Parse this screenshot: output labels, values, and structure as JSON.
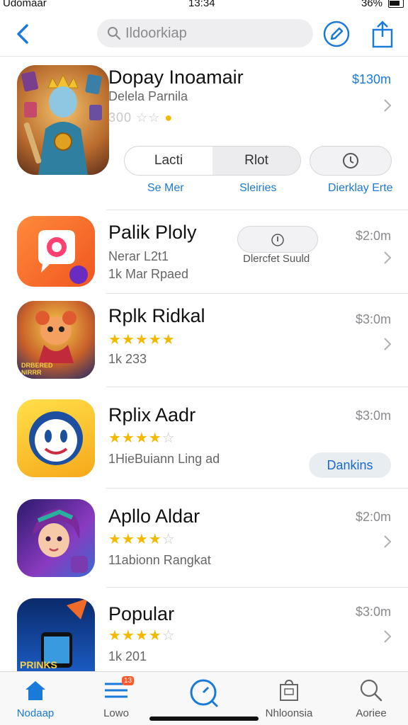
{
  "status": {
    "left": "Udomaar",
    "time": "13:34",
    "battery": "36%"
  },
  "search": {
    "placeholder": "Ildoorkiap"
  },
  "featured": {
    "name": "Dopay Inoamair",
    "developer": "Delela Parnila",
    "rating_text": "300",
    "price": "$130m",
    "segment_left": "Lacti",
    "segment_right": "Rlot",
    "link_1": "Se Mer",
    "link_2": "Sleiries",
    "link_3": "Dierklay Erte"
  },
  "apps": [
    {
      "name": "Palik Ploly",
      "sub1": "Nerar L2t1",
      "sub2": "1k Mar Rpaed",
      "price": "$2:0m",
      "pill": "Dlercfet Suuld"
    },
    {
      "name": "Rplk Ridkal",
      "rating": 5,
      "sub2": "1k 233",
      "price": "$3:0m",
      "icon_text": "DRBERED NIRRR"
    },
    {
      "name": "Rplix Aadr",
      "rating": 4,
      "sub2": "1HieBuiann Ling ad",
      "price": "$3:0m",
      "button": "Dankins"
    },
    {
      "name": "Apllo Aldar",
      "rating": 4,
      "sub2": "11abionn Rangkat",
      "price": "$2:0m"
    },
    {
      "name": "Popular",
      "rating": 4,
      "sub2": "1k 201",
      "price": "$3:0m",
      "icon_text": "PRINKS"
    }
  ],
  "tabs": [
    {
      "label": "Nodaap",
      "icon": "home-icon",
      "active": true
    },
    {
      "label": "Lowo",
      "icon": "list-icon",
      "badge": "13"
    },
    {
      "label": "",
      "icon": "search-circle-icon"
    },
    {
      "label": "Nhloonsia",
      "icon": "bag-icon"
    },
    {
      "label": "Aoriee",
      "icon": "search-icon"
    }
  ],
  "colors": {
    "accent": "#1a7ad9",
    "star": "#f5b800",
    "badge": "#ff5a2c"
  }
}
